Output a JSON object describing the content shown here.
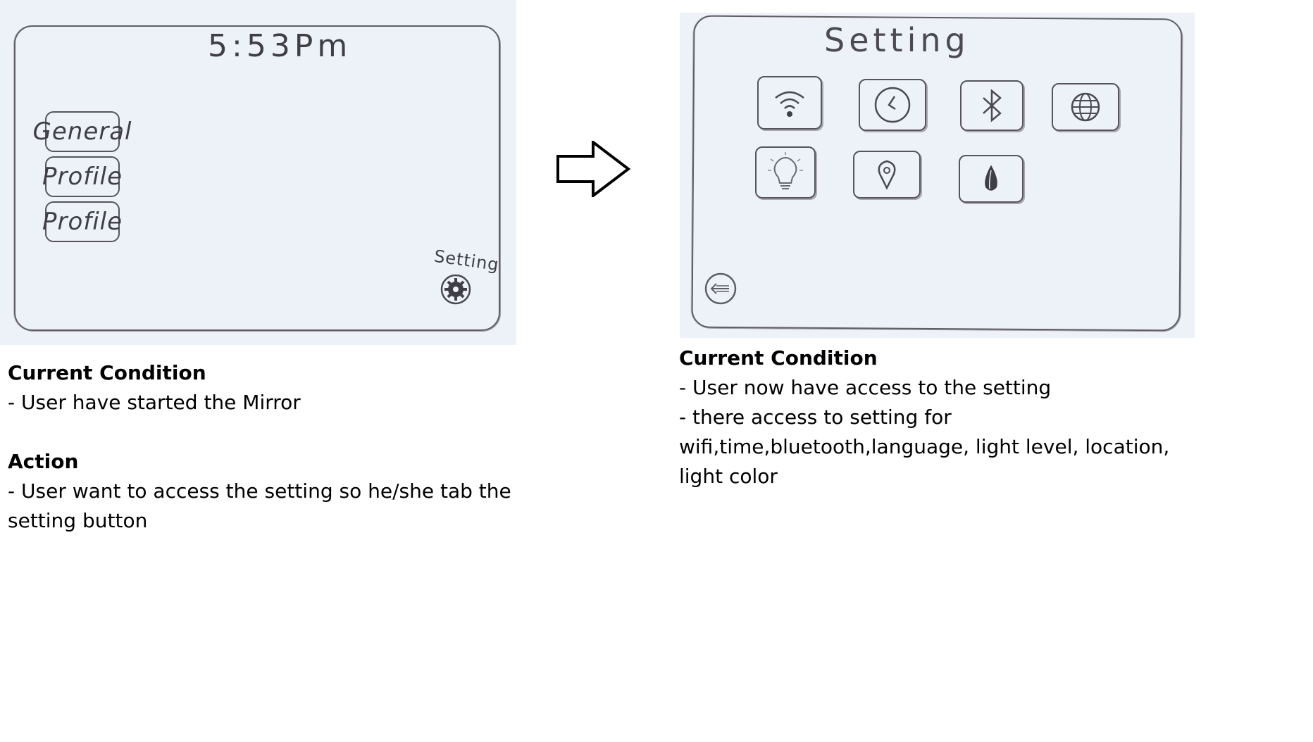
{
  "left_screen": {
    "time": "5:53Pm",
    "buttons": [
      "General",
      "Profile",
      "Profile"
    ],
    "setting_label": "Setting"
  },
  "right_screen": {
    "title": "Setting",
    "tiles": [
      "wifi-icon",
      "clock-icon",
      "bluetooth-icon",
      "globe-icon",
      "lightbulb-icon",
      "location-pin-icon",
      "color-drop-icon"
    ]
  },
  "left_text": {
    "heading1": "Current Condition",
    "line1": "- User have started the Mirror",
    "heading2": "Action",
    "line2": "- User want to access the setting so he/she tab the setting button"
  },
  "right_text": {
    "heading": "Current Condition",
    "line1": "- User now have access to the setting",
    "line2": "- there access to setting for wifi,time,bluetooth,language, light level, location, light color"
  }
}
